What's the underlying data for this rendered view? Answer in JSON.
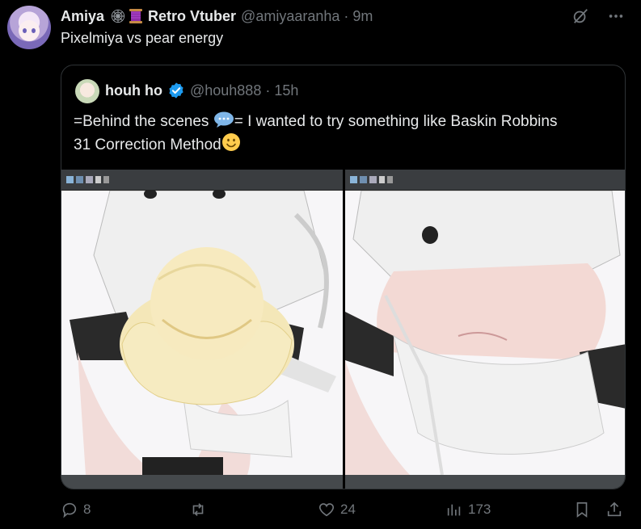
{
  "post": {
    "display_name": "Amiya",
    "display_name_2": "Retro Vtuber",
    "handle": "@amiyaaranha",
    "separator": "·",
    "time": "9m",
    "text": "Pixelmiya vs pear energy",
    "header_icons": [
      "grok-icon",
      "more-icon"
    ]
  },
  "quote": {
    "display_name": "houh ho",
    "handle": "@houh888",
    "separator": "·",
    "time": "15h",
    "verified": true,
    "text_line_1_before": "=Behind the scenes ",
    "text_line_1_after": "= I wanted to try something like Baskin Robbins",
    "text_line_2": "31 Correction Method",
    "inline_emojis": [
      "speech-bubble-icon",
      "slightly-smiling-face-icon"
    ],
    "media": [
      {
        "description_icon": "ice-cream-scoop-drawing"
      },
      {
        "description_icon": "belly-drawing"
      }
    ]
  },
  "actions": {
    "replies": "8",
    "reposts": "",
    "likes": "24",
    "views": "173"
  },
  "colors": {
    "background": "#000000",
    "text": "#e7e9ea",
    "muted": "#71767b",
    "border": "#2f3336",
    "verified_blue": "#1d9bf0"
  }
}
